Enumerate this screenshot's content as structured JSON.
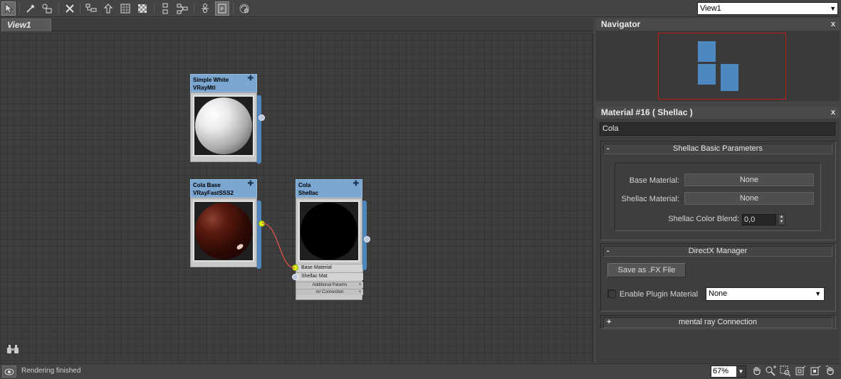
{
  "toolbar": {
    "icons": [
      "select-arrow",
      "eyedropper",
      "pick-material",
      "delete",
      "layout-children",
      "move-children",
      "hide-unused-slots",
      "show-background",
      "layout-all",
      "layout-children-vertical",
      "material-id-channel",
      "parameter-editor",
      "render-map"
    ],
    "view_select": "View1"
  },
  "view": {
    "tab_label": "View1"
  },
  "nodes": {
    "simple_white": {
      "name": "Simple White",
      "type": "VRayMtl"
    },
    "cola_base": {
      "name": "Cola Base",
      "type": "VRayFastSSS2"
    },
    "cola_shellac": {
      "name": "Cola",
      "type": "Shellac",
      "slots": [
        "Base Material",
        "Shellac Mat"
      ],
      "sub_rollouts": [
        "Additional Params",
        "mr Connection"
      ]
    }
  },
  "navigator": {
    "title": "Navigator"
  },
  "material_panel": {
    "title": "Material #16  ( Shellac )",
    "material_name": "Cola",
    "basic_params": {
      "title": "Shellac Basic Parameters",
      "base_material_label": "Base Material:",
      "base_material_value": "None",
      "shellac_material_label": "Shellac Material:",
      "shellac_material_value": "None",
      "color_blend_label": "Shellac Color Blend:",
      "color_blend_value": "0,0"
    },
    "directx": {
      "title": "DirectX Manager",
      "save_button": "Save as .FX File",
      "enable_plugin_label": "Enable Plugin Material",
      "plugin_dropdown": "None"
    },
    "mental_ray": {
      "title": "mental ray Connection"
    },
    "collapse_sign": "-",
    "expand_sign": "+"
  },
  "status_bar": {
    "text": "Rendering finished",
    "zoom": "67%"
  },
  "colors": {
    "node_header": "#7aa6d0",
    "socket_active": "#d8f21a",
    "wire": "#e0524a",
    "navigator_frame": "#c11a1a"
  }
}
